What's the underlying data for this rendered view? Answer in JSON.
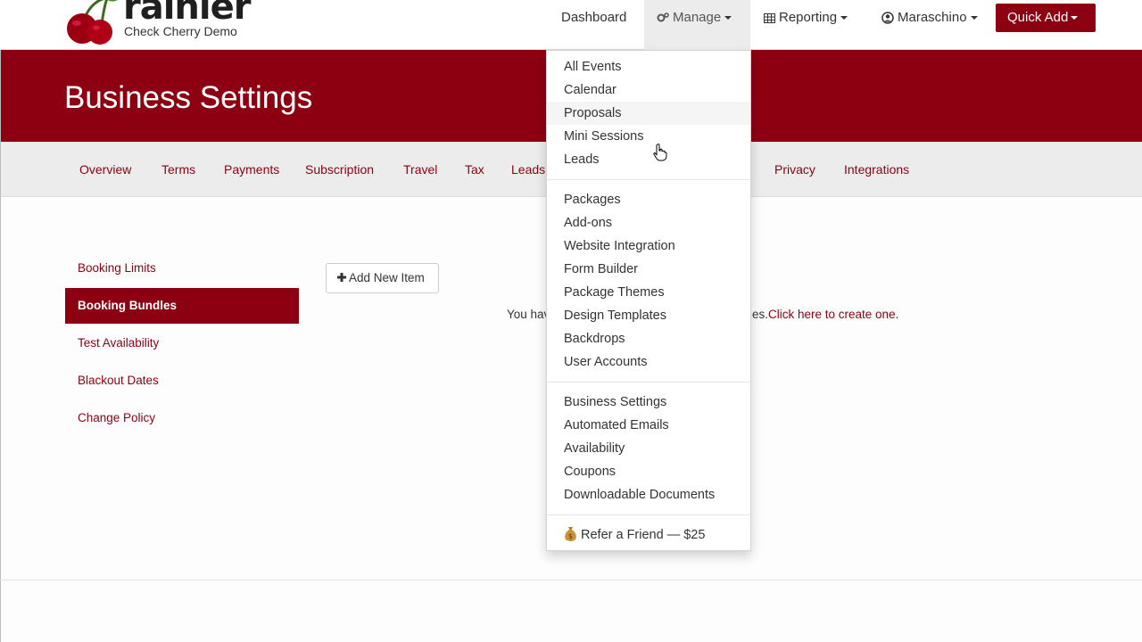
{
  "navbar": {
    "logo_text": "rainier",
    "logo_sub": "Check Cherry Demo",
    "dashboard": "Dashboard",
    "manage": "Manage",
    "reporting": "Reporting",
    "user": "Maraschino",
    "quick_add": "Quick Add"
  },
  "hero": {
    "title": "Business Settings"
  },
  "subnav": [
    {
      "label": "Overview"
    },
    {
      "label": "Terms"
    },
    {
      "label": "Payments"
    },
    {
      "label": "Subscription"
    },
    {
      "label": "Travel"
    },
    {
      "label": "Tax"
    },
    {
      "label": "Leads"
    },
    {
      "label": "Privacy"
    },
    {
      "label": "Integrations"
    }
  ],
  "sidebar": [
    {
      "label": "Booking Limits"
    },
    {
      "label": "Booking Bundles",
      "active": true
    },
    {
      "label": "Test Availability"
    },
    {
      "label": "Blackout Dates"
    },
    {
      "label": "Change Policy"
    }
  ],
  "main": {
    "add_button": "Add New Item",
    "empty_text_visible": "You hav",
    "empty_text_tail": "es.",
    "create_link": "Click here to create one."
  },
  "manage_menu": {
    "group1": [
      "All Events",
      "Calendar",
      "Proposals",
      "Mini Sessions",
      "Leads"
    ],
    "group2": [
      "Packages",
      "Add-ons",
      "Website Integration",
      "Form Builder",
      "Package Themes",
      "Design Templates",
      "Backdrops",
      "User Accounts"
    ],
    "group3": [
      "Business Settings",
      "Automated Emails",
      "Availability",
      "Coupons",
      "Downloadable Documents"
    ],
    "refer": "Refer a Friend — $25",
    "hovered": "Proposals"
  },
  "colors": {
    "brand": "#8c0011"
  }
}
